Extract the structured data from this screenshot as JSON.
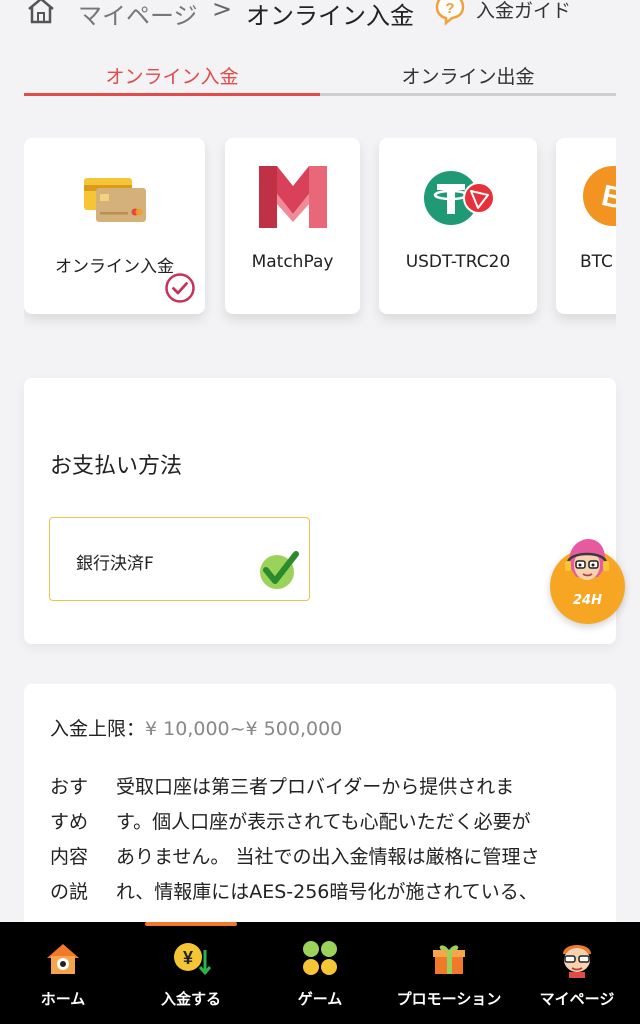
{
  "header": {
    "breadcrumb_parent": "マイページ",
    "breadcrumb_separator": ">",
    "breadcrumb_current": "オンライン入金",
    "guide_label": "入金ガイド"
  },
  "tabs": [
    {
      "label": "オンライン入金",
      "active": true
    },
    {
      "label": "オンライン出金",
      "active": false
    }
  ],
  "methods": [
    {
      "label": "オンライン入金",
      "icon": "credit-card-icon",
      "selected": true
    },
    {
      "label": "MatchPay",
      "icon": "matchpay-logo"
    },
    {
      "label": "USDT-TRC20",
      "icon": "tether-tron-logo"
    },
    {
      "label": "BTC",
      "icon": "bitcoin-logo"
    }
  ],
  "payment": {
    "title": "お支払い方法",
    "option_label": "銀行決済F",
    "option_selected": true
  },
  "support": {
    "label": "24H"
  },
  "info": {
    "limit_label": "入金上限：",
    "limit_value": "¥ 10,000~¥ 500,000",
    "side_lines": [
      "おす",
      "すめ",
      "内容",
      "の説"
    ],
    "body_lines": [
      "受取口座は第三者プロバイダーから提供されま",
      "す。個人口座が表示されても心配いただく必要が",
      "ありません。 当社での出入金情報は厳格に管理さ",
      "れ、情報庫にはAES-256暗号化が施されている、"
    ]
  },
  "bottom_nav": [
    {
      "label": "ホーム",
      "icon": "home-icon"
    },
    {
      "label": "入金する",
      "icon": "deposit-icon",
      "active": true
    },
    {
      "label": "ゲーム",
      "icon": "game-icon"
    },
    {
      "label": "プロモーション",
      "icon": "gift-icon"
    },
    {
      "label": "マイページ",
      "icon": "profile-icon"
    }
  ],
  "colors": {
    "accent": "#e34a4a",
    "option_border": "#f0c44a",
    "support_bg": "#f6a623",
    "nav_bg": "#000000",
    "nav_indicator": "#f07a2a"
  }
}
